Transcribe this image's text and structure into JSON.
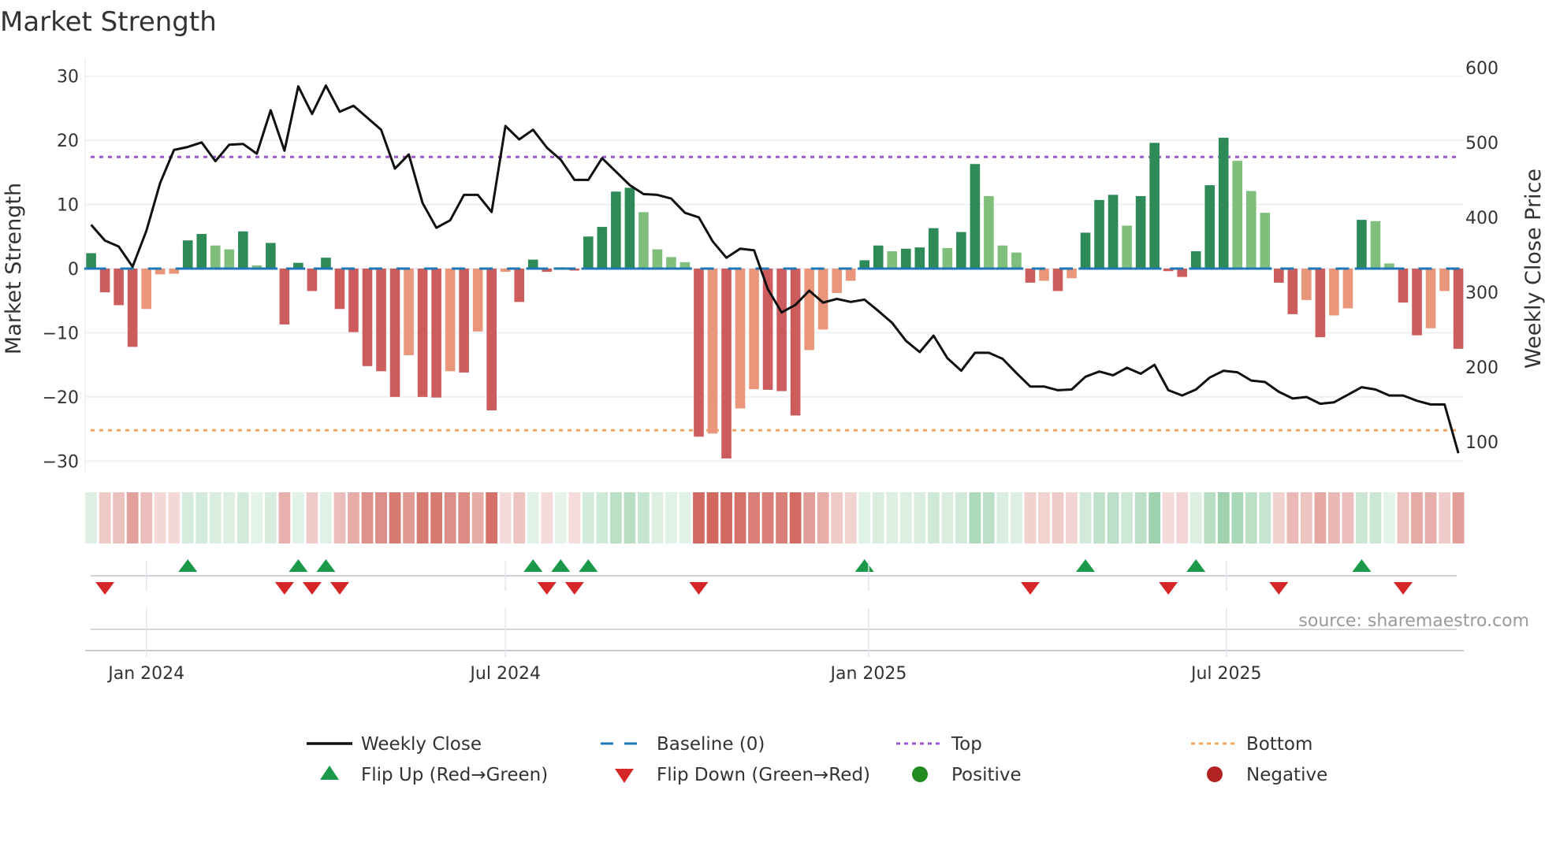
{
  "title": "Market Strength",
  "source": "source: sharemaestro.com",
  "legend": {
    "weekly_close": "Weekly Close",
    "baseline": "Baseline (0)",
    "top": "Top",
    "bottom": "Bottom",
    "flip_up": "Flip Up (Red→Green)",
    "flip_down": "Flip Down (Green→Red)",
    "positive": "Positive",
    "negative": "Negative"
  },
  "colors": {
    "strong_pos": "#2e8b57",
    "weak_pos": "#7fbf7b",
    "strong_neg": "#cd5c5c",
    "weak_neg": "#e9967a",
    "baseline": "#1f77b4",
    "top": "#9b59d0",
    "bottom": "#f4a460",
    "line": "#111111",
    "flip_up": "#1a9a48",
    "flip_down": "#d62728",
    "positive_dot": "#228b22",
    "negative_dot": "#b22222"
  },
  "chart_data": {
    "type": "bar+line",
    "title": "Market Strength",
    "ylabel": "Market Strength",
    "y2label": "Weekly Close Price",
    "ylim": [
      -31.8,
      31.8
    ],
    "y2lim": [
      59,
      604
    ],
    "yticks": [
      "30",
      "20",
      "10",
      "0",
      "−10",
      "−20",
      "−30"
    ],
    "ytick_values": [
      30,
      20,
      10,
      0,
      -10,
      -20,
      -30
    ],
    "y2ticks": [
      "600",
      "500",
      "400",
      "300",
      "200",
      "100"
    ],
    "y2tick_values": [
      600,
      500,
      400,
      300,
      200,
      100
    ],
    "xticks": [
      {
        "label": "Jan 2024",
        "week": 4.0
      },
      {
        "label": "Jul 2024",
        "week": 30.0
      },
      {
        "label": "Jan 2025",
        "week": 56.3
      },
      {
        "label": "Jul 2025",
        "week": 82.2
      }
    ],
    "top_level": 17.4,
    "bottom_level": -25.2,
    "strength": [
      2.4,
      -3.7,
      -5.7,
      -12.2,
      -6.3,
      -0.9,
      -0.8,
      4.4,
      5.4,
      3.6,
      3.0,
      5.8,
      0.5,
      4.0,
      -8.7,
      0.9,
      -3.5,
      1.7,
      -6.3,
      -9.9,
      -15.2,
      -16.0,
      -20.0,
      -13.5,
      -20.0,
      -20.1,
      -16.0,
      -16.2,
      -9.8,
      -22.1,
      -0.5,
      -5.2,
      1.4,
      -0.5,
      0.2,
      -0.3,
      5.0,
      6.5,
      12.0,
      12.6,
      8.8,
      3.0,
      1.8,
      1.0,
      -26.2,
      -25.7,
      -29.6,
      -21.8,
      -18.8,
      -18.9,
      -19.1,
      -22.9,
      -12.7,
      -9.5,
      -3.8,
      -1.9,
      1.3,
      3.6,
      2.7,
      3.1,
      3.3,
      6.3,
      3.2,
      5.7,
      16.3,
      11.3,
      3.6,
      2.5,
      -2.2,
      -1.9,
      -3.5,
      -1.5,
      5.6,
      10.7,
      11.5,
      6.7,
      11.3,
      19.6,
      -0.4,
      -1.3,
      2.7,
      13.0,
      20.4,
      16.8,
      12.1,
      8.7,
      -2.2,
      -7.1,
      -4.9,
      -10.7,
      -7.3,
      -6.2,
      7.6,
      7.4,
      0.8,
      -5.3,
      -10.4,
      -9.3,
      -3.5,
      -12.5
    ],
    "weekly_close": [
      390,
      369,
      361,
      334,
      382,
      446,
      490,
      494,
      500,
      475,
      497,
      498,
      485,
      543,
      489,
      575,
      538,
      576,
      541,
      549,
      533,
      517,
      465,
      484,
      419,
      386,
      396,
      430,
      430,
      407,
      522,
      504,
      517,
      493,
      477,
      450,
      450,
      479,
      461,
      443,
      431,
      430,
      425,
      406,
      400,
      368,
      346,
      358,
      356,
      304,
      273,
      283,
      302,
      286,
      291,
      287,
      290,
      275,
      259,
      235,
      220,
      242,
      212,
      195,
      219,
      219,
      211,
      192,
      174,
      174,
      169,
      170,
      187,
      194,
      189,
      199,
      191,
      203,
      169,
      162,
      170,
      186,
      195,
      193,
      182,
      180,
      167,
      158,
      160,
      151,
      153,
      163,
      173,
      170,
      162,
      162,
      155,
      150,
      150,
      85
    ],
    "flip_up_weeks": [
      7,
      15,
      17,
      32,
      34,
      36,
      56,
      72,
      80,
      92
    ],
    "flip_down_weeks": [
      1,
      14,
      16,
      18,
      33,
      35,
      44,
      68,
      78,
      86,
      95
    ]
  }
}
